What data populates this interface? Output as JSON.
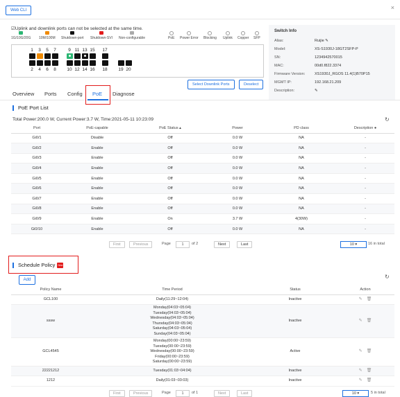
{
  "topbar": {
    "webcli_label": "Web CLI",
    "close": "×"
  },
  "ports": {
    "warning": "☑Uplink and downlink ports can not be selected at the same time.",
    "legend": [
      "1G/10G/20G",
      "10M/100M",
      "Shutdown-port",
      "Shutdown-SVI",
      "Non-configurable",
      "PoE",
      "Power Error",
      "Blocking",
      "Uplink",
      "Copper",
      "SFP"
    ],
    "top_numbers": [
      "1",
      "3",
      "5",
      "7",
      "9",
      "11",
      "13",
      "15",
      "17"
    ],
    "bottom_numbers": [
      "2",
      "4",
      "6",
      "8",
      "10",
      "12",
      "14",
      "16",
      "18",
      "19",
      "20"
    ],
    "select_downlink_label": "Select Downlink Ports",
    "deselect_label": "Deselect"
  },
  "switch_info": {
    "title": "Switch Info",
    "rows": [
      {
        "label": "Alias:",
        "value": "Ruijie"
      },
      {
        "label": "Model:",
        "value": "XS-S1930J-18GT2SFP-P"
      },
      {
        "label": "SN:",
        "value": "1234942570015"
      },
      {
        "label": "MAC:",
        "value": "00d0.f822.3374"
      },
      {
        "label": "Firmware Version:",
        "value": "XS1930J_RGOS 11.4(1)B70P15"
      },
      {
        "label": "MGMT IP:",
        "value": "192.168.21.209"
      },
      {
        "label": "Description:",
        "value": ""
      }
    ]
  },
  "tabs": [
    "Overview",
    "Ports",
    "Config",
    "PoE",
    "Diagnose"
  ],
  "poe": {
    "title": "PoE Port List",
    "summary": "Total Power:200.0 W, Current Power:3.7 W, Time:2021-05-11 10:23:09",
    "headers": [
      "Port",
      "PoE-capable",
      "PoE Status",
      "Power",
      "PD class",
      "Description"
    ],
    "rows": [
      [
        "Gi0/1",
        "Disable",
        "Off",
        "0.0 W",
        "NA",
        "-"
      ],
      [
        "Gi0/2",
        "Enable",
        "Off",
        "0.0 W",
        "NA",
        "-"
      ],
      [
        "Gi0/3",
        "Enable",
        "Off",
        "0.0 W",
        "NA",
        "-"
      ],
      [
        "Gi0/4",
        "Enable",
        "Off",
        "0.0 W",
        "NA",
        "-"
      ],
      [
        "Gi0/5",
        "Enable",
        "Off",
        "0.0 W",
        "NA",
        "-"
      ],
      [
        "Gi0/6",
        "Enable",
        "Off",
        "0.0 W",
        "NA",
        "-"
      ],
      [
        "Gi0/7",
        "Enable",
        "Off",
        "0.0 W",
        "NA",
        "-"
      ],
      [
        "Gi0/8",
        "Enable",
        "Off",
        "0.0 W",
        "NA",
        "-"
      ],
      [
        "Gi0/9",
        "Enable",
        "On",
        "3.7 W",
        "4(30W)",
        "-"
      ],
      [
        "Gi0/10",
        "Enable",
        "Off",
        "0.0 W",
        "NA",
        "-"
      ]
    ],
    "pager": {
      "first": "First",
      "prev": "Previous",
      "page": "Page",
      "current": "1",
      "of": "of 2",
      "next": "Next",
      "last": "Last",
      "per_page": "10",
      "total": "16 in total"
    }
  },
  "schedule": {
    "title": "Schedule Policy",
    "badge": "New",
    "add_label": "Add",
    "headers": [
      "Policy Name",
      "Time Period",
      "Status",
      "Action"
    ],
    "rows": [
      {
        "name": "GCL100",
        "period": [
          "Daily(11:29~12:04)"
        ],
        "status": "Inactive"
      },
      {
        "name": "sssw",
        "period": [
          "Monday(04:03~05:04)",
          "Tuesday(04:03~05:04)",
          "Wednesday(04:03~05:04)",
          "Thursday(04:03~05:04)",
          "Saturday(04:03~05:04)",
          "Sunday(04:03~05:04)"
        ],
        "status": "Inactive"
      },
      {
        "name": "GCL4545",
        "period": [
          "Monday(00:00~23:59)",
          "Tuesday(00:00~23:59)",
          "Wednesday(00:00~23:59)",
          "Friday(00:00~23:59)",
          "Saturday(00:00~23:59)"
        ],
        "status": "Active"
      },
      {
        "name": "22221212",
        "period": [
          "Tuesday(01:03~04:04)"
        ],
        "status": "Inactive"
      },
      {
        "name": "1212",
        "period": [
          "Daily(01:03~03:03)"
        ],
        "status": "Inactive"
      }
    ],
    "pager": {
      "first": "First",
      "prev": "Previous",
      "page": "Page",
      "current": "1",
      "of": "of 1",
      "next": "Next",
      "last": "Last",
      "per_page": "10",
      "total": "5 in total"
    }
  },
  "colors": {
    "accent": "#1b6fe0",
    "highlight": "#e21b1b",
    "orange": "#f08a00",
    "green": "#2bb673"
  }
}
